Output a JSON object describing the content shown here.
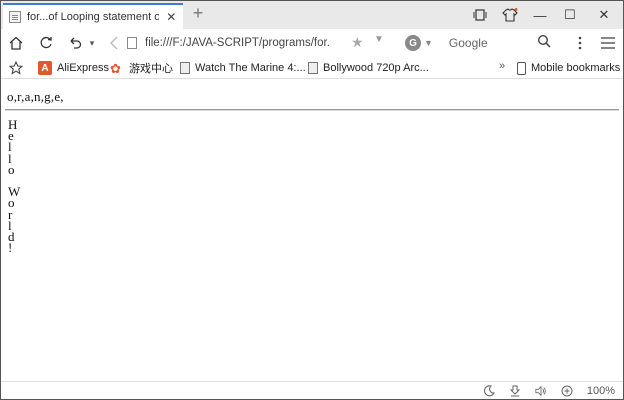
{
  "tab": {
    "title": "for...of Looping statement of JavaScript",
    "new_tab_label": "+"
  },
  "window_controls": {
    "minimize": "—",
    "maximize": "☐",
    "close": "✕"
  },
  "nav": {
    "url": "file:///F:/JAVA-SCRIPT/programs/for.",
    "search_engine_letter": "G",
    "search_placeholder": "Google"
  },
  "bookmarks": {
    "items": [
      {
        "label": "AliExpress",
        "icon": "aliexpress-icon"
      },
      {
        "label": "游戏中心",
        "icon": "game-center-icon"
      },
      {
        "label": "Watch The Marine 4:...",
        "icon": "page-icon"
      },
      {
        "label": "Bollywood 720p Arc...",
        "icon": "page-icon"
      }
    ],
    "overflow": "»",
    "mobile_label": "Mobile bookmarks"
  },
  "content": {
    "line1": "o,r,a,n,g,e,",
    "chars": [
      "H",
      "e",
      "l",
      "l",
      "o",
      "",
      "W",
      "o",
      "r",
      "l",
      "d",
      "!"
    ]
  },
  "status": {
    "zoom": "100%"
  }
}
